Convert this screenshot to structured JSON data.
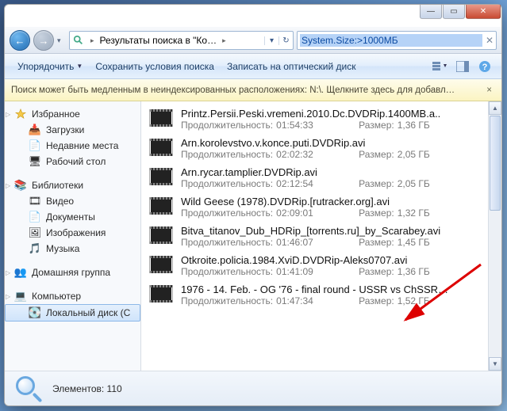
{
  "breadcrumb": {
    "text": "Результаты поиска в \"Ко…"
  },
  "search": {
    "value": "System.Size:>1000МБ"
  },
  "toolbar": {
    "organize": "Упорядочить",
    "save_search": "Сохранить условия поиска",
    "burn": "Записать на оптический диск"
  },
  "infobar": {
    "text": "Поиск может быть медленным в неиндексированных расположениях: N:\\. Щелкните здесь для добавл…"
  },
  "sidebar": {
    "favorites": "Избранное",
    "fav_items": [
      "Загрузки",
      "Недавние места",
      "Рабочий стол"
    ],
    "libraries": "Библиотеки",
    "lib_items": [
      "Видео",
      "Документы",
      "Изображения",
      "Музыка"
    ],
    "homegroup": "Домашняя группа",
    "computer": "Компьютер",
    "comp_items": [
      "Локальный диск (С"
    ]
  },
  "files": [
    {
      "name": "Printz.Persii.Peski.vremeni.2010.Dc.DVDRip.1400MB.a..",
      "dur": "01:54:33",
      "size": "1,36 ГБ"
    },
    {
      "name": "Arn.korolevstvo.v.konce.puti.DVDRip.avi",
      "dur": "02:02:32",
      "size": "2,05 ГБ"
    },
    {
      "name": "Arn.rycar.tamplier.DVDRip.avi",
      "dur": "02:12:54",
      "size": "2,05 ГБ"
    },
    {
      "name": "Wild Geese (1978).DVDRip.[rutracker.org].avi",
      "dur": "02:09:01",
      "size": "1,32 ГБ"
    },
    {
      "name": "Bitva_titanov_Dub_HDRip_[torrents.ru]_by_Scarabey.avi",
      "dur": "01:46:07",
      "size": "1,45 ГБ"
    },
    {
      "name": "Otkroite.policia.1984.XviD.DVDRip-Aleks0707.avi",
      "dur": "01:41:09",
      "size": "1,36 ГБ"
    },
    {
      "name": "1976 - 14. Feb. - OG '76 - final round - USSR vs ChSSR…",
      "dur": "01:47:34",
      "size": "1,52 ГБ"
    }
  ],
  "labels": {
    "duration": "Продолжительность:",
    "size": "Размер:",
    "elements": "Элементов:"
  },
  "status": {
    "count": "110"
  }
}
